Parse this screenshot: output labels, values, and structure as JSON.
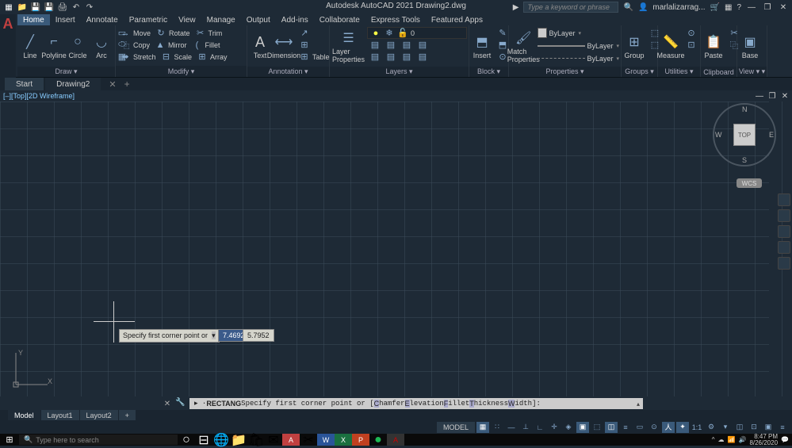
{
  "title": "Autodesk AutoCAD 2021   Drawing2.dwg",
  "search_placeholder": "Type a keyword or phrase",
  "user": "marlalizarrag...",
  "menu": [
    "Home",
    "Insert",
    "Annotate",
    "Parametric",
    "View",
    "Manage",
    "Output",
    "Add-ins",
    "Collaborate",
    "Express Tools",
    "Featured Apps"
  ],
  "panels": {
    "draw": {
      "title": "Draw ▾",
      "tools": [
        "Line",
        "Polyline",
        "Circle",
        "Arc"
      ]
    },
    "modify": {
      "title": "Modify ▾",
      "rows": [
        [
          "↔",
          "Move",
          "↻",
          "Rotate",
          "✂",
          "Trim"
        ],
        [
          "⿻",
          "Copy",
          "▲",
          "Mirror",
          "(",
          "Fillet"
        ],
        [
          "⬌",
          "Stretch",
          "⊟",
          "Scale",
          "⊞",
          "Array"
        ]
      ]
    },
    "annotation": {
      "title": "Annotation ▾",
      "text": "Text",
      "dim": "Dimension",
      "table": "Table"
    },
    "layers": {
      "title": "Layers ▾",
      "lp": "Layer\nProperties",
      "layer0": "0"
    },
    "block": {
      "title": "Block ▾",
      "insert": "Insert"
    },
    "properties": {
      "title": "Properties ▾",
      "match": "Match\nProperties",
      "bylayer": "ByLayer"
    },
    "groups": {
      "title": "Groups ▾",
      "group": "Group"
    },
    "utilities": {
      "title": "Utilities ▾",
      "measure": "Measure"
    },
    "clipboard": {
      "title": "Clipboard",
      "paste": "Paste"
    },
    "view": {
      "title": "View ▾ ▾",
      "base": "Base"
    }
  },
  "doc_tabs": [
    "Start",
    "Drawing2"
  ],
  "vp_label": "[–][Top][2D Wireframe]",
  "tooltip": "Specify first corner point or",
  "coord1": "7.4692",
  "coord2": "5.7952",
  "viewcube": {
    "face": "TOP",
    "n": "N",
    "s": "S",
    "e": "E",
    "w": "W"
  },
  "wcs": "WCS",
  "cmd": {
    "prefix": "▸ · ",
    "keyword": "RECTANG",
    "text": " Specify first corner point or [",
    "opts": [
      "Chamfer",
      "Elevation",
      "Fillet",
      "Thickness",
      "Width"
    ],
    "suffix": "]: "
  },
  "layout_tabs": [
    "Model",
    "Layout1",
    "Layout2"
  ],
  "model_badge": "MODEL",
  "scale": "1:1",
  "taskbar_search": "Type here to search",
  "clock": {
    "time": "8:47 PM",
    "date": "8/26/2020"
  },
  "ucs": {
    "x": "X",
    "y": "Y"
  }
}
